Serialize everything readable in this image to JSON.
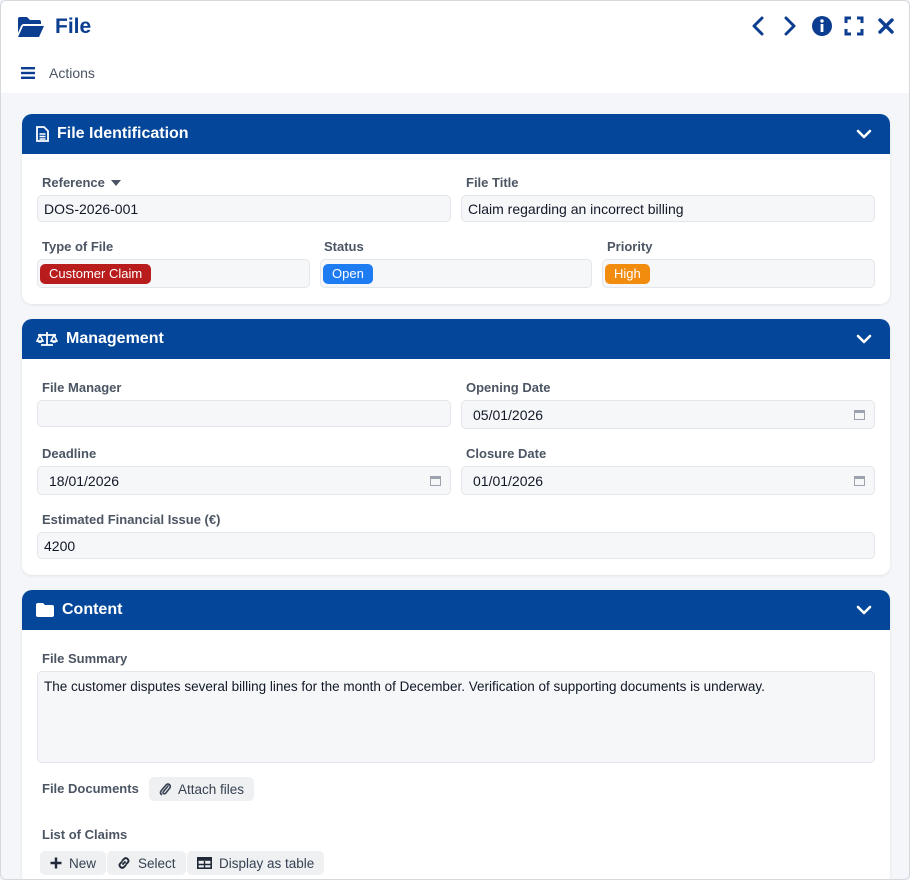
{
  "window": {
    "title": "File",
    "actions_label": "Actions"
  },
  "colors": {
    "brand": "#03469a",
    "claim_badge": "#b91c1c",
    "status_badge": "#1e7cf2",
    "priority_badge": "#f28c0f"
  },
  "sections": {
    "identification": {
      "title": "File Identification",
      "reference_label": "Reference",
      "reference_value": "DOS-2026-001",
      "file_title_label": "File Title",
      "file_title_value": "Claim regarding an incorrect billing",
      "type_label": "Type of File",
      "type_value": "Customer Claim",
      "status_label": "Status",
      "status_value": "Open",
      "priority_label": "Priority",
      "priority_value": "High"
    },
    "management": {
      "title": "Management",
      "manager_label": "File Manager",
      "manager_value": "",
      "opening_label": "Opening Date",
      "opening_value": "05/01/2026",
      "deadline_label": "Deadline",
      "deadline_value": "18/01/2026",
      "closure_label": "Closure Date",
      "closure_value": "01/01/2026",
      "issue_label": "Estimated Financial Issue (€)",
      "issue_value": "4200"
    },
    "content": {
      "title": "Content",
      "summary_label": "File Summary",
      "summary_value": "The customer disputes several billing lines for the month of December. Verification of supporting documents is underway.",
      "documents_label": "File Documents",
      "attach_label": "Attach files",
      "claims_label": "List of Claims",
      "new_label": "New",
      "select_label": "Select",
      "table_label": "Display as table"
    }
  }
}
